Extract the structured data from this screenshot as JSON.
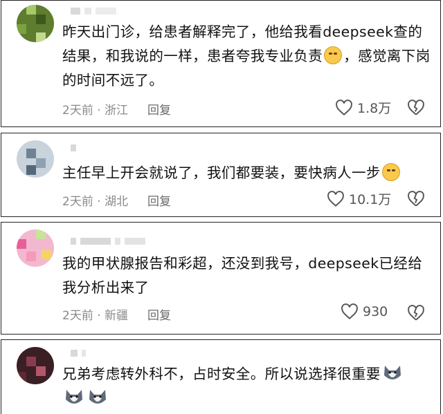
{
  "comments": [
    {
      "text": "昨天出门诊，给患者解释完了，他给我看deepseek查的结果，和我说的一样，患者夸我专业负责",
      "text_after_emoji": "，感觉离下岗的时间不远了。",
      "meta": "2天前 · 浙江",
      "reply": "回复",
      "likes": "1.8万",
      "emoji": "crying-laughing"
    },
    {
      "text": "主任早上开会就说了，我们都要装，要快病人一步",
      "meta": "2天前 · 湖北",
      "reply": "回复",
      "likes": "10.1万",
      "emoji": "worried-sweat"
    },
    {
      "text": "我的甲状腺报告和彩超，还没到我号，deepseek已经给我分析出来了",
      "meta": "2天前 · 新疆",
      "reply": "回复",
      "likes": "930"
    },
    {
      "text": "兄弟考虑转外科不，占时安全。所以说选择很重要",
      "emoji": "husky-dog"
    }
  ],
  "icons": {
    "like": "heart-outline-icon",
    "dislike": "broken-heart-icon"
  },
  "colors": {
    "text": "#111111",
    "meta": "#8a8a8a",
    "border": "#222222"
  }
}
